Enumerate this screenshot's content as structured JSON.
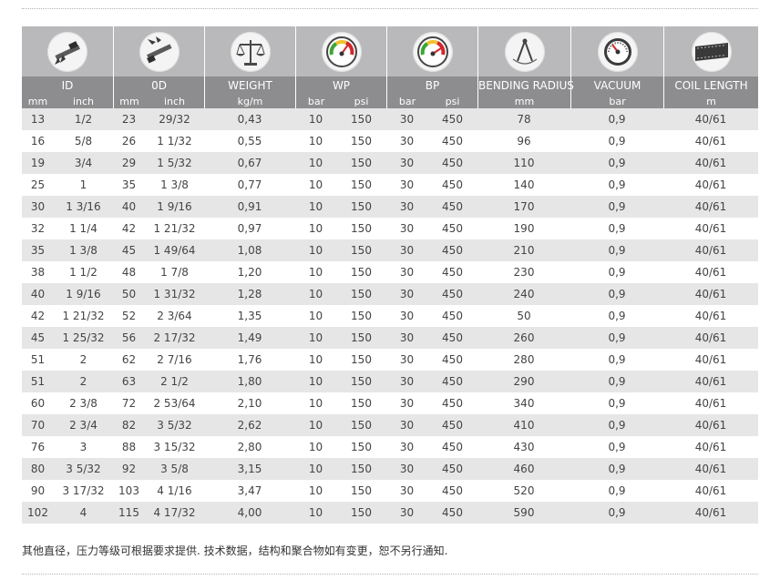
{
  "columns": [
    {
      "key": "id",
      "icon": "caliper-icon",
      "label": "ID",
      "units": [
        "mm",
        "inch"
      ]
    },
    {
      "key": "od",
      "icon": "caliper-outer-icon",
      "label": "0D",
      "units": [
        "mm",
        "inch"
      ]
    },
    {
      "key": "weight",
      "icon": "balance-scale-icon",
      "label": "WEIGHT",
      "units": [
        "kg/m"
      ]
    },
    {
      "key": "wp",
      "icon": "pressure-gauge-icon",
      "label": "WP",
      "units": [
        "bar",
        "psi"
      ]
    },
    {
      "key": "bp",
      "icon": "pressure-gauge-icon",
      "label": "BP",
      "units": [
        "bar",
        "psi"
      ]
    },
    {
      "key": "bending_radius",
      "icon": "compass-icon",
      "label": "BENDING RADIUS",
      "units": [
        "mm"
      ]
    },
    {
      "key": "vacuum",
      "icon": "vacuum-gauge-icon",
      "label": "VACUUM",
      "units": [
        "bar"
      ]
    },
    {
      "key": "coil_length",
      "icon": "coil-tape-icon",
      "label": "COIL LENGTH",
      "units": [
        "m"
      ]
    }
  ],
  "rows": [
    [
      "13",
      "1/2",
      "23",
      "29/32",
      "0,43",
      "10",
      "150",
      "30",
      "450",
      "78",
      "0,9",
      "40/61"
    ],
    [
      "16",
      "5/8",
      "26",
      "1 1/32",
      "0,55",
      "10",
      "150",
      "30",
      "450",
      "96",
      "0,9",
      "40/61"
    ],
    [
      "19",
      "3/4",
      "29",
      "1 5/32",
      "0,67",
      "10",
      "150",
      "30",
      "450",
      "110",
      "0,9",
      "40/61"
    ],
    [
      "25",
      "1",
      "35",
      "1 3/8",
      "0,77",
      "10",
      "150",
      "30",
      "450",
      "140",
      "0,9",
      "40/61"
    ],
    [
      "30",
      "1 3/16",
      "40",
      "1 9/16",
      "0,91",
      "10",
      "150",
      "30",
      "450",
      "170",
      "0,9",
      "40/61"
    ],
    [
      "32",
      "1 1/4",
      "42",
      "1 21/32",
      "0,97",
      "10",
      "150",
      "30",
      "450",
      "190",
      "0,9",
      "40/61"
    ],
    [
      "35",
      "1 3/8",
      "45",
      "1 49/64",
      "1,08",
      "10",
      "150",
      "30",
      "450",
      "210",
      "0,9",
      "40/61"
    ],
    [
      "38",
      "1 1/2",
      "48",
      "1 7/8",
      "1,20",
      "10",
      "150",
      "30",
      "450",
      "230",
      "0,9",
      "40/61"
    ],
    [
      "40",
      "1 9/16",
      "50",
      "1 31/32",
      "1,28",
      "10",
      "150",
      "30",
      "450",
      "240",
      "0,9",
      "40/61"
    ],
    [
      "42",
      "1 21/32",
      "52",
      "2 3/64",
      "1,35",
      "10",
      "150",
      "30",
      "450",
      "50",
      "0,9",
      "40/61"
    ],
    [
      "45",
      "1 25/32",
      "56",
      "2 17/32",
      "1,49",
      "10",
      "150",
      "30",
      "450",
      "260",
      "0,9",
      "40/61"
    ],
    [
      "51",
      "2",
      "62",
      "2 7/16",
      "1,76",
      "10",
      "150",
      "30",
      "450",
      "280",
      "0,9",
      "40/61"
    ],
    [
      "51",
      "2",
      "63",
      "2 1/2",
      "1,80",
      "10",
      "150",
      "30",
      "450",
      "290",
      "0,9",
      "40/61"
    ],
    [
      "60",
      "2 3/8",
      "72",
      "2 53/64",
      "2,10",
      "10",
      "150",
      "30",
      "450",
      "340",
      "0,9",
      "40/61"
    ],
    [
      "70",
      "2 3/4",
      "82",
      "3 5/32",
      "2,62",
      "10",
      "150",
      "30",
      "450",
      "410",
      "0,9",
      "40/61"
    ],
    [
      "76",
      "3",
      "88",
      "3 15/32",
      "2,80",
      "10",
      "150",
      "30",
      "450",
      "430",
      "0,9",
      "40/61"
    ],
    [
      "80",
      "3 5/32",
      "92",
      "3 5/8",
      "3,15",
      "10",
      "150",
      "30",
      "450",
      "460",
      "0,9",
      "40/61"
    ],
    [
      "90",
      "3 17/32",
      "103",
      "4 1/16",
      "3,47",
      "10",
      "150",
      "30",
      "450",
      "520",
      "0,9",
      "40/61"
    ],
    [
      "102",
      "4",
      "115",
      "4 17/32",
      "4,00",
      "10",
      "150",
      "30",
      "450",
      "590",
      "0,9",
      "40/61"
    ]
  ],
  "footnote": "其他直径，压力等级可根据要求提供. 技术数据，结构和聚合物如有变更，恕不另行通知.",
  "colors": {
    "icon_row_bg": "#b9b9bb",
    "header_bg": "#8d8d8f",
    "row_alt_bg": "#e6e6e6",
    "gauge_red": "#d3262b",
    "gauge_green": "#3aa635",
    "gauge_yellow": "#f2c22e"
  }
}
